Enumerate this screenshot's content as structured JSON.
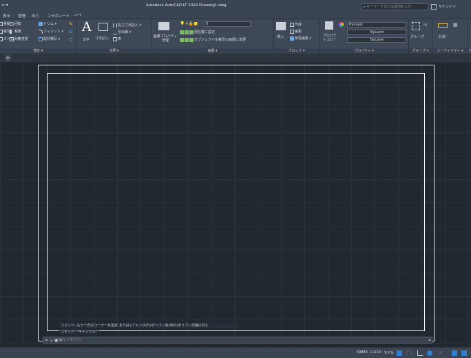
{
  "title_bar": {
    "quick_access": "↔ ▾",
    "app_title": "Autodesk AutoCAD LT 2019    Drawing1.dwg",
    "search_placeholder": "▸ キーワードまたは語句を入力",
    "user_label": "サインイン"
  },
  "ribbon_tabs": [
    "表示",
    "管理",
    "出力",
    "コラボレート",
    "▭ ▾"
  ],
  "ribbon": {
    "modify": {
      "title": "修正 ▾",
      "items": [
        "移動",
        "回転",
        "トリム ▾",
        "複写",
        "鏡像",
        "フィレット ▾",
        "ストレッチ",
        "尺度変更",
        "配列複写 ▾"
      ]
    },
    "annotation": {
      "title": "注釈 ▾",
      "items": [
        "文字",
        "寸法記入",
        "長さ寸法記入 ▾",
        "引出線 ▾",
        "表"
      ]
    },
    "layers": {
      "title": "画層 ▾",
      "current_layer": "0",
      "items": [
        "画層プロパティ管理",
        "現在層に設定",
        "オブジェクトを複写の画層に変更"
      ]
    },
    "block": {
      "title": "ブロック ▾",
      "items": [
        "挿入",
        "作成",
        "編集",
        "属性編集 ▾"
      ]
    },
    "properties": {
      "title": "プロパティ ▾",
      "copy_label": "プロパティコピー",
      "color": "ByLayer",
      "linetype": "ByLayer",
      "lineweight": "ByLayer"
    },
    "groups": {
      "title": "グループ ▾",
      "label": "グループ"
    },
    "utilities": {
      "title": "ユーティリティ ▾",
      "label": "計測"
    },
    "clipboard": {
      "title": "ク"
    }
  },
  "command": {
    "history_1": "コマンド: もう一方のコーナーを指定 または [フェンス(F)/ポリゴン窓(WP)/ポリゴン交差(CP)]:",
    "history_2": "コマンド: *キャンセル*",
    "close_icon_label": "✕ ↘ ▣ ▾",
    "placeholder": "コマンドを入力",
    "arrow": "▴"
  },
  "status": {
    "coordinates": "50883, 11110",
    "model_label": "モデル"
  },
  "colors": {
    "canvas": "#212830",
    "grid": "#2a323c",
    "ribbon": "#3f4857",
    "accent": "#2f7fd0",
    "layer_bulb": "#f5d23a"
  }
}
